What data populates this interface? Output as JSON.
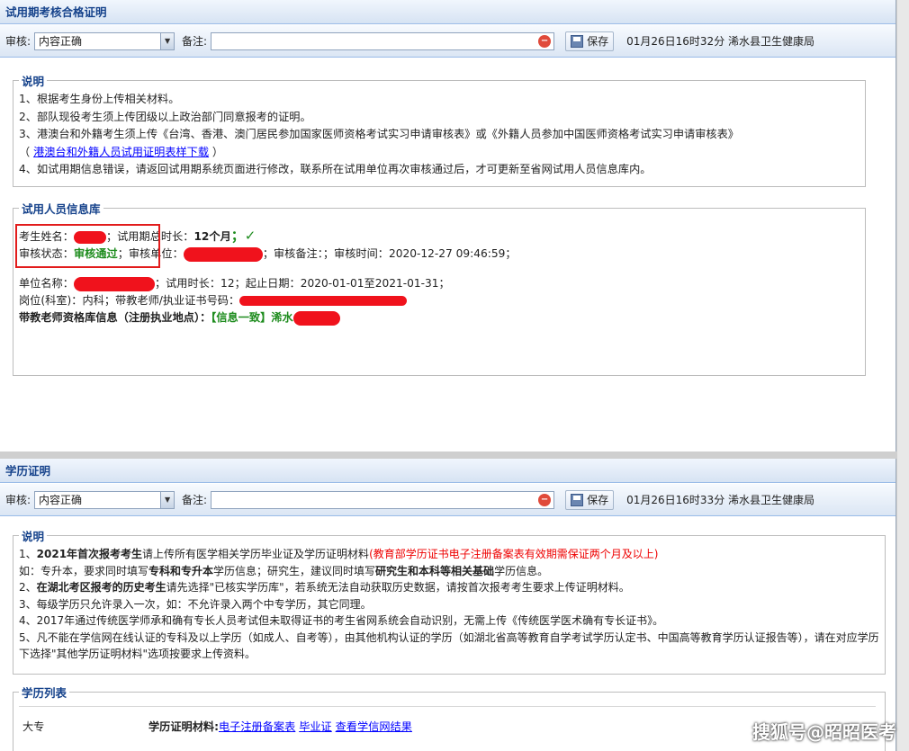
{
  "section1": {
    "title": "试用期考核合格证明",
    "toolbar": {
      "audit_label": "审核:",
      "audit_value": "内容正确",
      "memo_label": "备注:",
      "memo_value": "",
      "save_label": "保存",
      "stamp": "01月26日16时32分 浠水县卫生健康局"
    },
    "notes": {
      "legend": "说明",
      "lines": [
        "1、根据考生身份上传相关材料。",
        "2、部队现役考生须上传团级以上政治部门同意报考的证明。",
        "3、港澳台和外籍考生须上传《台湾、香港、澳门居民参加国家医师资格考试实习申请审核表》或《外籍人员参加中国医师资格考试实习申请审核表》"
      ],
      "line4_prefix": "（ ",
      "line4_link": "港澳台和外籍人员试用证明表样下载",
      "line4_suffix": " ）",
      "line5": "4、如试用期信息错误，请返回试用期系统页面进行修改，联系所在试用单位再次审核通过后，才可更新至省网试用人员信息库内。"
    },
    "info": {
      "legend": "试用人员信息库",
      "name_label": "考生姓名：",
      "duration_label": "；试用期总时长：",
      "duration_value": "12个月",
      "check": "；✓",
      "status_label": "审核状态：",
      "status_value": "审核通过",
      "unit_label": "；审核单位：",
      "remark": "；审核备注：；审核时间：2020-12-27 09:46:59；",
      "unit_name_label": "单位名称：",
      "unit_rest": "；试用时长：12；起止日期：2020-01-01至2021-01-31；",
      "post": "岗位(科室)：内科；带教老师/执业证书号码：",
      "teacher_label": "带教老师资格库信息（注册执业地点）：",
      "teacher_value": "【信息一致】浠水"
    }
  },
  "section2": {
    "title": "学历证明",
    "toolbar": {
      "audit_label": "审核:",
      "audit_value": "内容正确",
      "memo_label": "备注:",
      "memo_value": "",
      "save_label": "保存",
      "stamp": "01月26日16时33分 浠水县卫生健康局"
    },
    "notes": {
      "legend": "说明",
      "l1_a": "1、",
      "l1_b": "2021年首次报考考生",
      "l1_c": "请上传所有医学相关学历毕业证及学历证明材料",
      "l1_d": "(教育部学历证书电子注册备案表有效期需保证两个月及以上)",
      "l2_a": "如：专升本，要求同时填写",
      "l2_b": "专科和专升本",
      "l2_c": "学历信息；研究生，建议同时填写",
      "l2_d": "研究生和本科等相关基础",
      "l2_e": "学历信息。",
      "l3_a": "2、",
      "l3_b": "在湖北考区报考的历史考生",
      "l3_c": "请先选择\"已核实学历库\"，若系统无法自动获取历史数据，请按首次报考考生要求上传证明材料。",
      "l4": "3、每级学历只允许录入一次，如：不允许录入两个中专学历，其它同理。",
      "l5": "4、2017年通过传统医学师承和确有专长人员考试但未取得证书的考生省网系统会自动识别，无需上传《传统医学医术确有专长证书》。",
      "l6": "5、凡不能在学信网在线认证的专科及以上学历（如成人、自考等），由其他机构认证的学历（如湖北省高等教育自学考试学历认定书、中国高等教育学历认证报告等），请在对应学历下选择\"其他学历证明材料\"选项按要求上传资料。"
    },
    "list": {
      "legend": "学历列表",
      "level": "大专",
      "mat_label": "学历证明材料:",
      "link1": "电子注册备案表",
      "link2": "毕业证",
      "link3": "查看学信网结果"
    }
  },
  "watermark": "搜狐号@昭昭医考"
}
